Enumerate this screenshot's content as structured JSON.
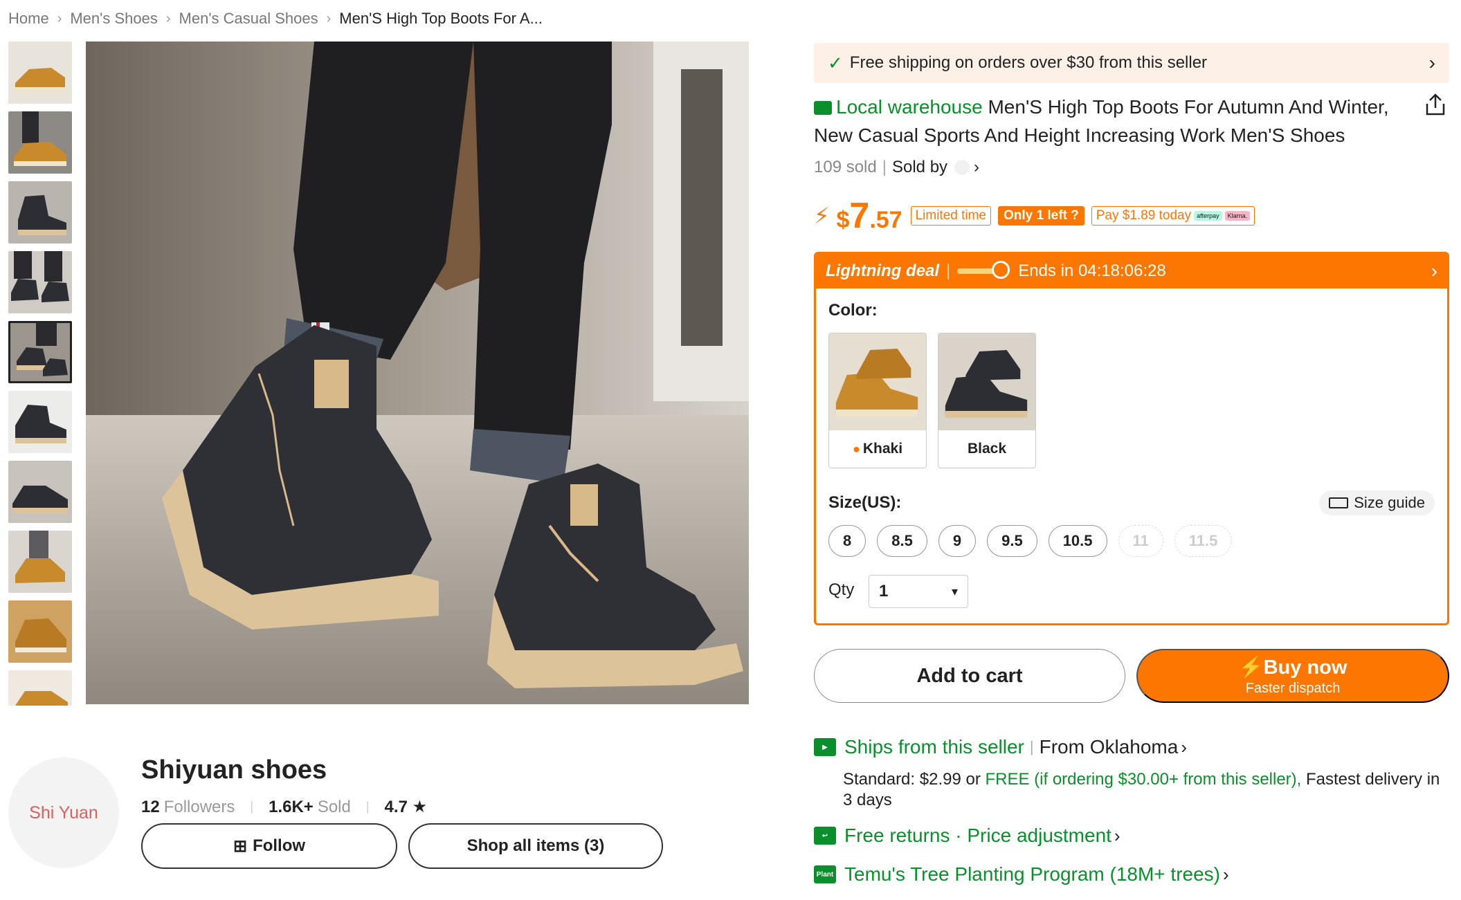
{
  "breadcrumb": {
    "items": [
      "Home",
      "Men's Shoes",
      "Men's Casual Shoes",
      "Men'S High Top Boots For A..."
    ],
    "separator": "›"
  },
  "store": {
    "avatar_text": "Shi Yuan",
    "name": "Shiyuan shoes",
    "followers_value": "12",
    "followers_label": "Followers",
    "sold_value": "1.6K+",
    "sold_label": "Sold",
    "rating": "4.7 ★",
    "follow_label": "Follow",
    "shop_all_label": "Shop all items (3)"
  },
  "shipping_banner": {
    "check": "✓",
    "text": "Free shipping on orders over $30 from this seller",
    "chevron": "›"
  },
  "product": {
    "local_warehouse": "Local warehouse",
    "title": "Men'S High Top Boots For Autumn And Winter, New Casual Sports And Height Increasing Work Men'S Shoes",
    "sold_count": "109 sold",
    "sold_by": "Sold by",
    "price_currency": "$",
    "price_int": "7",
    "price_dec": ".57",
    "tag_limited": "Limited time",
    "tag_stock": "Only 1 left",
    "tag_pay": "Pay $1.89 today",
    "afterpay_badge": "afterpay",
    "klarna_badge": "Klarna."
  },
  "deal": {
    "label": "Lightning deal",
    "ends_text": "Ends in 04:18:06:28"
  },
  "color": {
    "label": "Color:",
    "options": [
      {
        "name": "Khaki",
        "selected": true,
        "hot": true
      },
      {
        "name": "Black",
        "selected": false,
        "hot": false
      }
    ]
  },
  "size": {
    "label": "Size(US):",
    "guide_label": "Size guide",
    "options": [
      {
        "label": "8",
        "available": true
      },
      {
        "label": "8.5",
        "available": true
      },
      {
        "label": "9",
        "available": true
      },
      {
        "label": "9.5",
        "available": true
      },
      {
        "label": "10.5",
        "available": true
      },
      {
        "label": "11",
        "available": false
      },
      {
        "label": "11.5",
        "available": false
      }
    ]
  },
  "qty": {
    "label": "Qty",
    "value": "1"
  },
  "actions": {
    "add_to_cart": "Add to cart",
    "buy_now": "Buy now",
    "buy_now_sub": "Faster dispatch"
  },
  "ships": {
    "from_seller": "Ships from this seller",
    "from_location": "From Oklahoma",
    "standard_prefix": "Standard: $2.99 or ",
    "free_text": "FREE (if ordering $30.00+ from this seller),",
    "fastest_text": " Fastest delivery in 3 days"
  },
  "returns": {
    "text": "Free returns · Price adjustment"
  },
  "tree": {
    "icon_text": "Plant",
    "text": "Temu's Tree Planting Program (18M+ trees)"
  },
  "colors": {
    "accent": "#fb7701",
    "green": "#0a8f2c",
    "banner_bg": "#fdf0e6"
  },
  "icons": {
    "share": "share-icon",
    "truck": "truck-icon",
    "return": "return-icon",
    "plant": "plant-icon",
    "bolt": "lightning-icon",
    "ruler": "ruler-icon"
  }
}
